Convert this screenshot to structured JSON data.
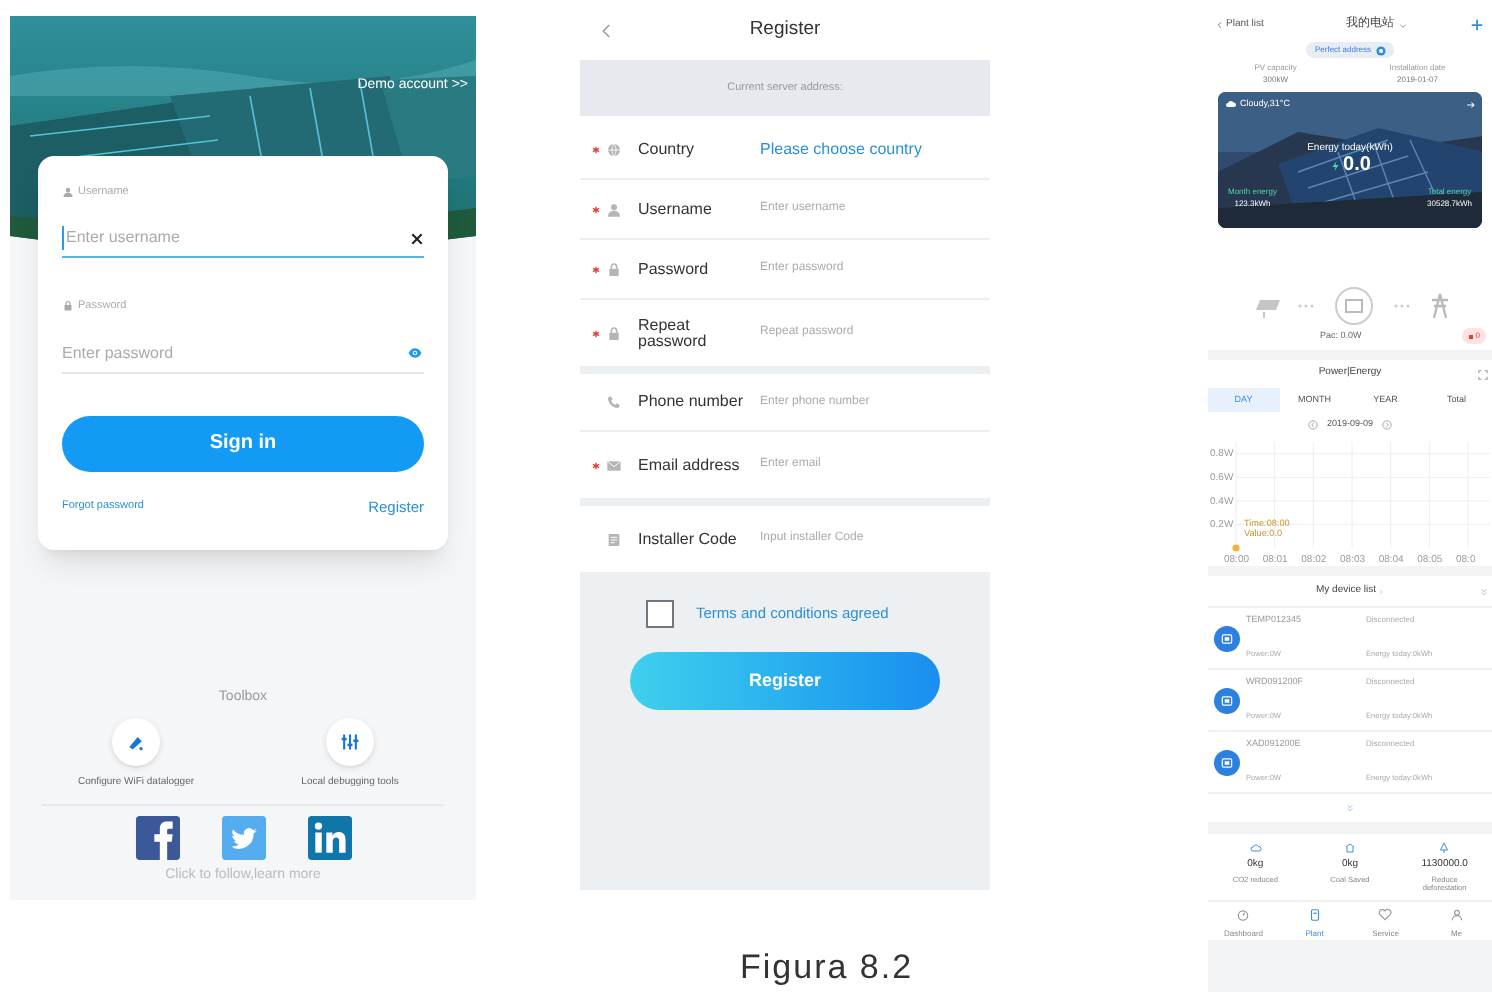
{
  "login_screen": {
    "demo_link": "Demo account >>",
    "username": {
      "label": "Username",
      "placeholder": "Enter username"
    },
    "password": {
      "label": "Password",
      "placeholder": "Enter password"
    },
    "sign_in": "Sign in",
    "forgot_password": "Forgot password",
    "register": "Register",
    "toolbox": {
      "title": "Toolbox",
      "tools": [
        {
          "kind": "wifi",
          "label": "Configure WiFi datalogger"
        },
        {
          "kind": "debug",
          "label": "Local debugging tools"
        }
      ]
    },
    "social": [
      {
        "kind": "facebook"
      },
      {
        "kind": "twitter"
      },
      {
        "kind": "linkedin"
      }
    ],
    "follow_text": "Click to follow,learn more"
  },
  "register_screen": {
    "title": "Register",
    "server_label": "Current server address:",
    "field_groups": [
      [
        {
          "kind": "country",
          "required": true,
          "label": "Country",
          "placeholder": "Please choose country"
        },
        {
          "kind": "user",
          "required": true,
          "label": "Username",
          "placeholder": "Enter username"
        },
        {
          "kind": "password",
          "required": true,
          "label": "Password",
          "placeholder": "Enter password"
        },
        {
          "kind": "password",
          "required": true,
          "label": "Repeat password",
          "placeholder": "Repeat password"
        }
      ],
      [
        {
          "kind": "phone",
          "required": false,
          "label": "Phone number",
          "placeholder": "Enter phone number"
        },
        {
          "kind": "email",
          "required": true,
          "label": "Email address",
          "placeholder": "Enter email"
        }
      ],
      [
        {
          "kind": "installer",
          "required": false,
          "label": "Installer Code",
          "placeholder": "Input installer Code"
        }
      ]
    ],
    "terms": {
      "label": "Terms and conditions agreed",
      "checked": false
    },
    "button": "Register"
  },
  "plant_screen": {
    "back": "Plant list",
    "title": "我的电站",
    "address_badge": "Perfect address",
    "stats": [
      {
        "label": "PV capacity",
        "value": "300kW"
      },
      {
        "label": "Installation date",
        "value": "2019-01-07"
      }
    ],
    "card": {
      "weather": "Cloudy,31°C",
      "energy_label": "Energy today(kWh)",
      "energy_value": "0.0",
      "month_label": "Month energy",
      "month_value": "123.3kWh",
      "total_label": "Total energy",
      "total_value": "30528.7kWh"
    },
    "pac": "Pac: 0.0W",
    "alarm_count": "0",
    "power_panel": {
      "title": "Power|Energy",
      "tabs": [
        {
          "label": "DAY",
          "selected": true
        },
        {
          "label": "MONTH",
          "selected": false
        },
        {
          "label": "YEAR",
          "selected": false
        },
        {
          "label": "Total",
          "selected": false
        }
      ],
      "date": "2019-09-09",
      "chart_data": {
        "type": "line",
        "categories": [
          "08:00",
          "08:01",
          "08:02",
          "08:03",
          "08:04",
          "08:05",
          "08:0"
        ],
        "yticks": [
          {
            "value": 0.2,
            "label": "0.2W"
          },
          {
            "value": 0.4,
            "label": "0.4W"
          },
          {
            "value": 0.6,
            "label": "0.6W"
          },
          {
            "value": 0.8,
            "label": "0.8W"
          }
        ],
        "ylim": [
          0,
          0.9
        ],
        "grid": true,
        "series": [
          {
            "color": "#f0b63c",
            "marker": true,
            "values": [
              0,
              null,
              null,
              null,
              null,
              null,
              null
            ]
          }
        ],
        "annotations": [
          "Time:08:00",
          "Value:0.0"
        ]
      }
    },
    "device_list": {
      "title": "My device list",
      "devices": [
        {
          "serial": "TEMP012345",
          "status": "Disconnected",
          "power": "Power:0W",
          "energy": "Energy today:0kWh"
        },
        {
          "serial": "WRD091200F",
          "status": "Disconnected",
          "power": "Power:0W",
          "energy": "Energy today:0kWh"
        },
        {
          "serial": "XAD091200E",
          "status": "Disconnected",
          "power": "Power:0W",
          "energy": "Energy today:0kWh"
        }
      ]
    },
    "impact": [
      {
        "kind": "co2",
        "value": "0kg",
        "label": "CO2 reduced"
      },
      {
        "kind": "coal",
        "value": "0kg",
        "label": "Coal Saved"
      },
      {
        "kind": "tree",
        "value": "1130000.0",
        "label": "Reduce deforestation"
      }
    ],
    "nav": [
      {
        "kind": "dashboard",
        "label": "Dashboard",
        "selected": false
      },
      {
        "kind": "plant",
        "label": "Plant",
        "selected": true
      },
      {
        "kind": "service",
        "label": "Service",
        "selected": false
      },
      {
        "kind": "me",
        "label": "Me",
        "selected": false
      }
    ]
  },
  "caption": "Figura 8.2"
}
